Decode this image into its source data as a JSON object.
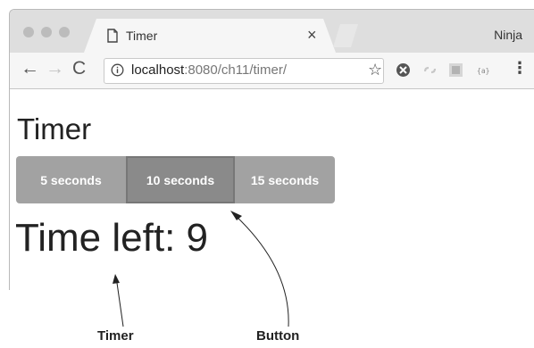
{
  "browser": {
    "tab_title": "Timer",
    "tab_close": "×",
    "profile_name": "Ninja",
    "url_host": "localhost",
    "url_rest": ":8080/ch11/timer/",
    "nav_back": "←",
    "nav_forward": "→",
    "nav_reload": "C",
    "bookmark_star": "☆",
    "menu_dots": "⋮"
  },
  "page": {
    "title": "Timer",
    "buttons": [
      "5 seconds",
      "10 seconds",
      "15 seconds"
    ],
    "active_button_index": 1,
    "time_left": "Time left: 9"
  },
  "annotations": {
    "timer_label": "Timer",
    "button_label": "Button"
  }
}
